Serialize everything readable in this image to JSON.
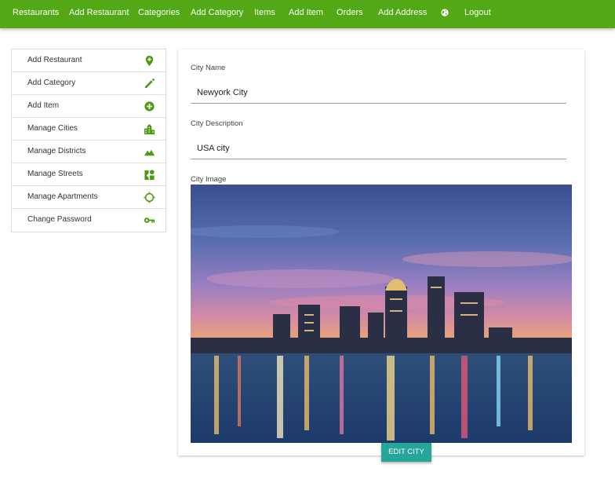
{
  "nav": {
    "items": [
      "Restaurants",
      "Add Restaurant",
      "Categories",
      "Add Category",
      "Items",
      "Add Item",
      "Orders",
      "Add Address"
    ],
    "globe_icon": "globe-icon",
    "logout": "Logout"
  },
  "sidebar": {
    "items": [
      {
        "label": "Add Restaurant",
        "icon": "location-add-icon"
      },
      {
        "label": "Add Category",
        "icon": "pencil-icon"
      },
      {
        "label": "Add Item",
        "icon": "plus-circle-icon"
      },
      {
        "label": "Manage Cities",
        "icon": "city-icon"
      },
      {
        "label": "Manage Districts",
        "icon": "terrain-icon"
      },
      {
        "label": "Manage Streets",
        "icon": "map-icon"
      },
      {
        "label": "Manage Apartments",
        "icon": "crosshair-icon"
      },
      {
        "label": "Change Password",
        "icon": "key-icon"
      }
    ]
  },
  "form": {
    "city_name_label": "City Name",
    "city_name_value": "Newyork City",
    "city_description_label": "City Description",
    "city_description_value": "USA city",
    "city_image_label": "City Image",
    "submit_label": "EDIT CITY"
  },
  "colors": {
    "nav_bg": "#53a816",
    "icon_green": "#4a9a12",
    "button_teal": "#26a69a"
  }
}
